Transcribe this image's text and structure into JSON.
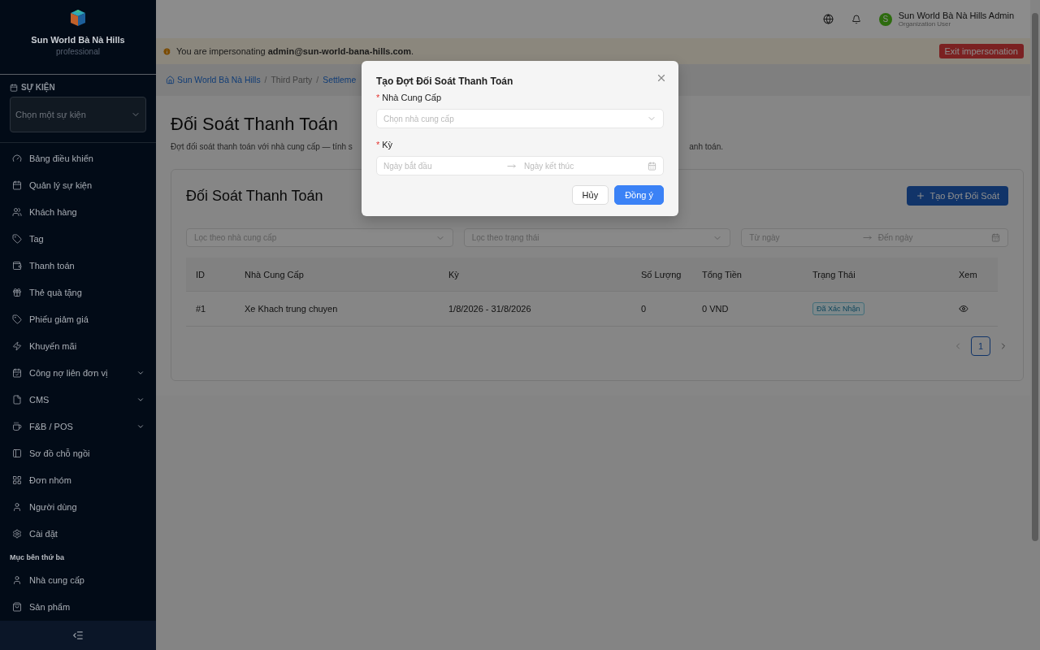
{
  "sidebar": {
    "brand": "Sun World Bà Nà Hills",
    "plan": "professional",
    "event_section": {
      "label": "SỰ KIỆN",
      "select_placeholder": "Chọn một sự kiện"
    },
    "items": [
      {
        "label": "Bảng điều khiển",
        "expandable": false
      },
      {
        "label": "Quản lý sự kiện",
        "expandable": false
      },
      {
        "label": "Khách hàng",
        "expandable": false
      },
      {
        "label": "Tag",
        "expandable": false
      },
      {
        "label": "Thanh toán",
        "expandable": false
      },
      {
        "label": "Thẻ quà tặng",
        "expandable": false
      },
      {
        "label": "Phiếu giảm giá",
        "expandable": false
      },
      {
        "label": "Khuyến mãi",
        "expandable": false
      },
      {
        "label": "Công nợ liên đơn vị",
        "expandable": true
      },
      {
        "label": "CMS",
        "expandable": true
      },
      {
        "label": "F&B / POS",
        "expandable": true
      },
      {
        "label": "Sơ đồ chỗ ngồi",
        "expandable": false
      },
      {
        "label": "Đơn nhóm",
        "expandable": false
      },
      {
        "label": "Người dùng",
        "expandable": false
      },
      {
        "label": "Cài đặt",
        "expandable": false
      }
    ],
    "group_label": "Mục bên thứ ba",
    "group_items": [
      {
        "label": "Nhà cung cấp",
        "expandable": false
      },
      {
        "label": "Sản phẩm",
        "expandable": false
      }
    ]
  },
  "header": {
    "user_initial": "S",
    "user_name": "Sun World Bà Nà Hills Admin",
    "user_role": "Organization User"
  },
  "banner": {
    "text": "You are impersonating **admin@sun-world-bana-hills.com**.",
    "button": "Exit impersonation"
  },
  "breadcrumb": {
    "items": [
      "Sun World Bà Nà Hills",
      "Third Party",
      "Settleme"
    ],
    "separators": [
      "/",
      "/"
    ]
  },
  "page": {
    "title": "Đối Soát Thanh Toán",
    "description_left": "Đợt đối soát thanh toán với nhà cung cấp — tính s",
    "description_right": "anh toán."
  },
  "card": {
    "title": "Đối Soát Thanh Toán",
    "create_button": "Tạo Đợt Đối Soát",
    "filters": {
      "supplier_placeholder": "Lọc theo nhà cung cấp",
      "status_placeholder": "Lọc theo trạng thái",
      "date_from": "Từ ngày",
      "date_to": "Đến ngày"
    },
    "table": {
      "columns": [
        "ID",
        "Nhà Cung Cấp",
        "Kỳ",
        "Số Lượng",
        "Tổng Tiền",
        "Trạng Thái",
        "Xem"
      ],
      "rows": [
        {
          "id": "#1",
          "supplier": "Xe Khach trung chuyen",
          "period": "1/8/2026 - 31/8/2026",
          "quantity": "0",
          "total": "0 VND",
          "status": "Đã Xác Nhận"
        }
      ]
    },
    "pagination": {
      "pages": [
        {
          "label": "1",
          "selected": true
        }
      ]
    }
  },
  "dialog": {
    "title": "Tạo Đợt Đối Soát Thanh Toán",
    "fields": [
      {
        "kind": "select",
        "label": "Nhà Cung Cấp",
        "required_mark": "*",
        "placeholder": "Chọn nhà cung cấp"
      },
      {
        "kind": "range",
        "label": "Kỳ",
        "required_mark": "*",
        "placeholder": "Ngày bắt đầu",
        "placeholder_end": "Ngày kết thúc"
      }
    ],
    "buttons": [
      {
        "label": "Hủy",
        "primary": false
      },
      {
        "label": "Đồng ý",
        "primary": true
      }
    ]
  }
}
